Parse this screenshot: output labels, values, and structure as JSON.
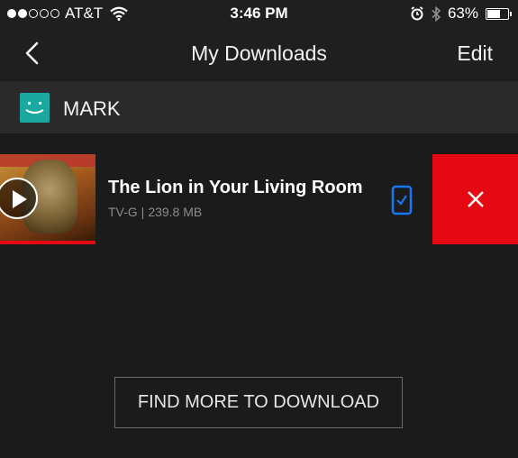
{
  "status_bar": {
    "carrier": "AT&T",
    "time": "3:46 PM",
    "battery_percent": "63%",
    "battery_level": 0.63,
    "signal_bars_filled": 2,
    "signal_bars_total": 5
  },
  "nav": {
    "title": "My Downloads",
    "edit_label": "Edit"
  },
  "profile": {
    "name": "MARK"
  },
  "downloads": [
    {
      "title": "The Lion in Your Living Room",
      "rating": "TV-G",
      "separator": "|",
      "size": "239.8 MB"
    }
  ],
  "actions": {
    "find_more_label": "FIND MORE TO DOWNLOAD"
  },
  "colors": {
    "accent_red": "#e50914",
    "avatar_teal": "#1aa8a0",
    "check_blue": "#1877f2"
  },
  "icons": [
    "wifi-icon",
    "alarm-icon",
    "bluetooth-icon",
    "battery-icon",
    "chevron-left-icon",
    "play-icon",
    "downloaded-check-icon",
    "close-icon"
  ]
}
